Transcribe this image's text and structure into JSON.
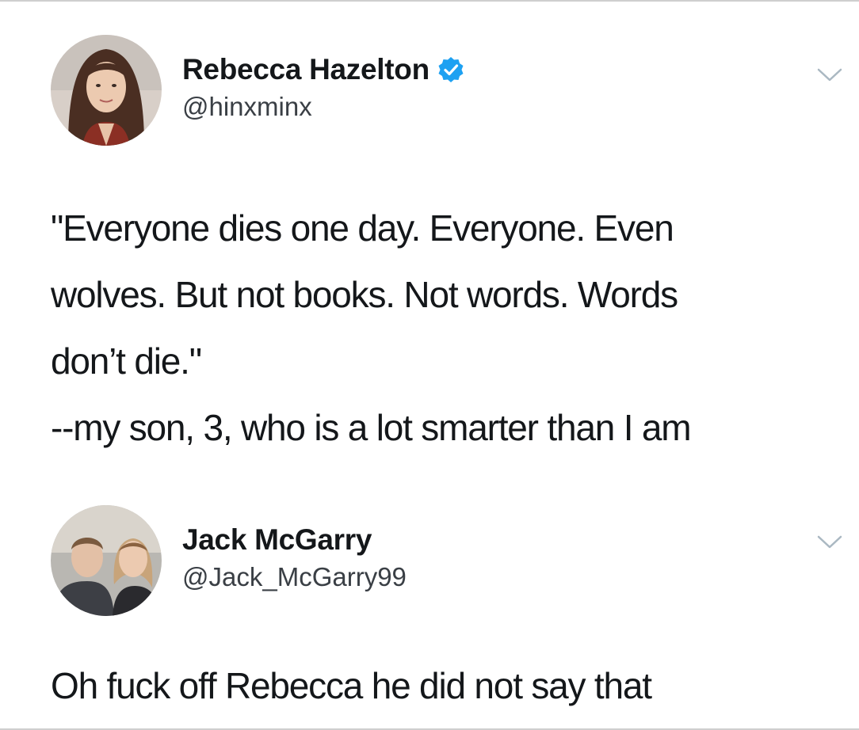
{
  "tweets": [
    {
      "avatar_icon": "avatar-woman-icon",
      "display_name": "Rebecca Hazelton",
      "verified": true,
      "handle": "@hinxminx",
      "text_lines": [
        "\"Everyone dies one day. Everyone. Even",
        "wolves. But not books. Not words. Words",
        "don’t die.\"",
        "--my son, 3, who is a lot smarter than I am"
      ]
    },
    {
      "avatar_icon": "avatar-couple-icon",
      "display_name": "Jack McGarry",
      "verified": false,
      "handle": "@Jack_McGarry99",
      "text": "Oh fuck off Rebecca he did not say that"
    }
  ],
  "colors": {
    "text": "#14171a",
    "handle": "#3a3f45",
    "verified_badge": "#1da1f2",
    "chevron": "#aab8c2",
    "border": "#cfcfcf"
  },
  "icons": {
    "verified": "verified-badge-icon",
    "menu": "chevron-down-icon"
  }
}
